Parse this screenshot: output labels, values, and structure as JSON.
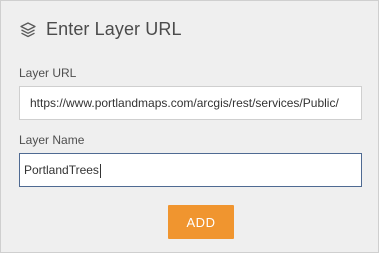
{
  "dialog": {
    "title": "Enter Layer URL",
    "icon": "layers-icon"
  },
  "layer_url": {
    "label": "Layer URL",
    "value": "https://www.portlandmaps.com/arcgis/rest/services/Public/"
  },
  "layer_name": {
    "label": "Layer Name",
    "value": "PortlandTrees"
  },
  "actions": {
    "add_label": "ADD"
  },
  "colors": {
    "accent": "#f0952f",
    "focus_border": "#4f6a92",
    "panel_bg": "#efefef"
  }
}
